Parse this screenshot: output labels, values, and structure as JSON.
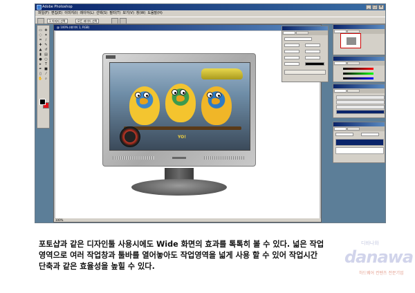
{
  "app": {
    "title": "Adobe Photoshop",
    "menu": [
      "파일(F)",
      "편집(E)",
      "이미지(I)",
      "레이어(L)",
      "선택(S)",
      "필터(T)",
      "보기(V)",
      "창(W)",
      "도움말(H)"
    ],
    "window_buttons": [
      "_",
      "□",
      "×"
    ]
  },
  "options_bar": {
    "chip_1": "1 이미지 선택",
    "chip_2": "모든 레이어 선택"
  },
  "document": {
    "title": "@ 100% (레이어 1, RGB)",
    "status": "100%"
  },
  "screen": {
    "scene_text": "YO!"
  },
  "caption": {
    "lines": [
      "포토샵과 같은 디자인툴 사용시에도 Wide 화면의 효과를 톡톡히 볼 수 있다. 넓은 작업",
      "영역으로 여러 작업창과 툴바를 열어놓아도 작업영역을 넓게 사용 할 수 있어 작업시간",
      "단축과 같은 효율성을 높힐 수 있다."
    ]
  },
  "watermark": {
    "logo": "danawa",
    "sub": "디바나와",
    "tag": "하드웨어 컨텐츠 전문기업"
  },
  "colors": {
    "foreground": "#000000",
    "background": "#e4131b",
    "title_blue": "#0a246a"
  }
}
